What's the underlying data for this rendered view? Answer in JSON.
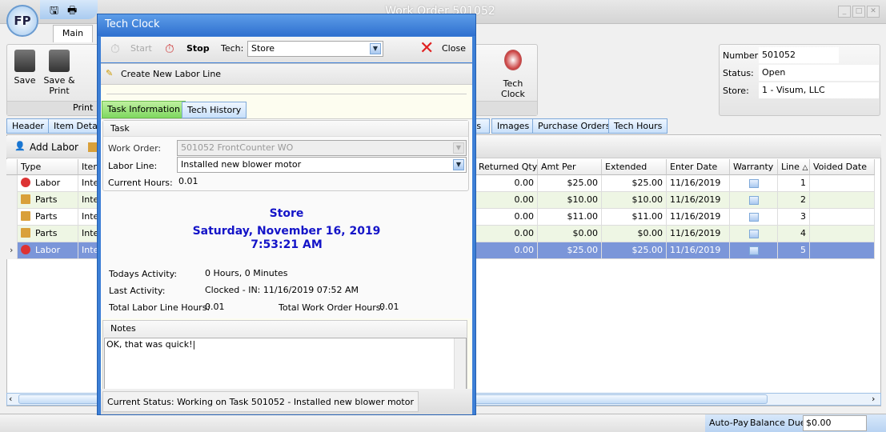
{
  "window": {
    "title": "Work Order 501052",
    "logo": "FP",
    "ribbon_tab": "Main"
  },
  "ribbon": {
    "save": "Save",
    "save_print": "Save & Print",
    "print_group": "Print",
    "tech_clock": "Tech Clock"
  },
  "info": {
    "number_label": "Number:",
    "number": "501052",
    "status_label": "Status:",
    "status": "Open",
    "store_label": "Store:",
    "store": "1 - Visum, LLC"
  },
  "tabs": [
    "Header",
    "Item Details",
    "ts",
    "Images",
    "Purchase Orders",
    "Tech Hours"
  ],
  "grid_toolbar": {
    "add_labor": "Add Labor"
  },
  "grid": {
    "columns": [
      "Type",
      "Item",
      "Returned Qty",
      "Amt Per",
      "Extended",
      "Enter Date",
      "Warranty",
      "Line",
      "Voided Date"
    ],
    "rows": [
      {
        "type": "Labor",
        "item": "Inte",
        "returned": "0.00",
        "amt": "$25.00",
        "ext": "$25.00",
        "date": "11/16/2019",
        "line": "1"
      },
      {
        "type": "Parts",
        "item": "Inte",
        "returned": "0.00",
        "amt": "$10.00",
        "ext": "$10.00",
        "date": "11/16/2019",
        "line": "2"
      },
      {
        "type": "Parts",
        "item": "Inte",
        "returned": "0.00",
        "amt": "$11.00",
        "ext": "$11.00",
        "date": "11/16/2019",
        "line": "3"
      },
      {
        "type": "Parts",
        "item": "Inte",
        "returned": "0.00",
        "amt": "$0.00",
        "ext": "$0.00",
        "date": "11/16/2019",
        "line": "4"
      },
      {
        "type": "Labor",
        "item": "Inte",
        "returned": "0.00",
        "amt": "$25.00",
        "ext": "$25.00",
        "date": "11/16/2019",
        "line": "5"
      }
    ]
  },
  "statusbar": {
    "autopay": "Auto-Pay",
    "balance_label": "Balance Due:",
    "balance": "$0.00"
  },
  "dialog": {
    "title": "Tech Clock",
    "start": "Start",
    "stop": "Stop",
    "tech_label": "Tech:",
    "tech": "Store",
    "close": "Close",
    "create_labor": "Create New Labor Line",
    "tabs": [
      "Task Information",
      "Tech History"
    ],
    "task_group": "Task",
    "work_order_label": "Work Order:",
    "work_order": "501052 FrontCounter WO",
    "labor_line_label": "Labor Line:",
    "labor_line": "Installed new blower motor",
    "current_hours_label": "Current Hours:",
    "current_hours": "0.01",
    "store": "Store",
    "date": "Saturday, November 16, 2019",
    "time": "7:53:21 AM",
    "todays_label": "Todays Activity:",
    "todays": "0 Hours, 0 Minutes",
    "last_label": "Last Activity:",
    "last": "Clocked - IN: 11/16/2019 07:52 AM",
    "total_line_label": "Total Labor Line Hours:",
    "total_line": "0.01",
    "total_wo_label": "Total Work Order Hours:",
    "total_wo": "0.01",
    "notes_label": "Notes",
    "notes": "OK, that was quick!",
    "current_status": "Current Status: Working on Task 501052 - Installed new blower motor"
  }
}
